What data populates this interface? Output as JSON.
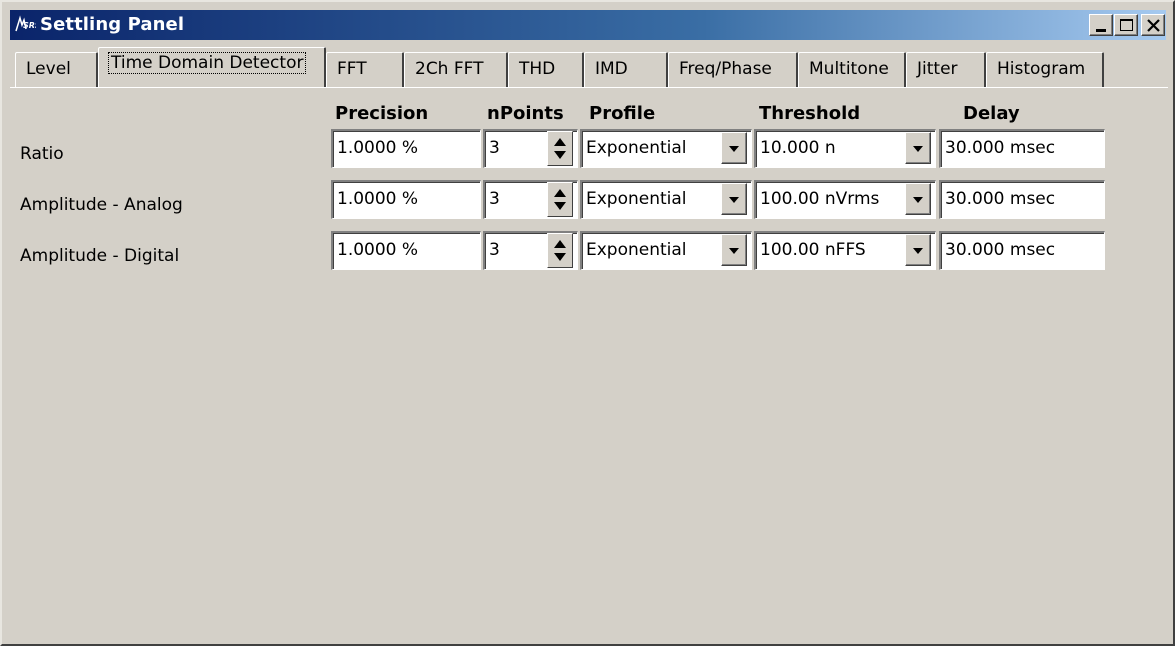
{
  "window": {
    "title": "Settling Panel",
    "app_icon": "srs-logo-icon",
    "buttons": [
      "minimize-icon",
      "maximize-icon",
      "close-icon"
    ]
  },
  "tabs": [
    {
      "label": "Level",
      "active": false
    },
    {
      "label": "Time Domain Detector",
      "active": true
    },
    {
      "label": "FFT",
      "active": false
    },
    {
      "label": "2Ch FFT",
      "active": false
    },
    {
      "label": "THD",
      "active": false
    },
    {
      "label": "IMD",
      "active": false
    },
    {
      "label": "Freq/Phase",
      "active": false
    },
    {
      "label": "Multitone",
      "active": false
    },
    {
      "label": "Jitter",
      "active": false
    },
    {
      "label": "Histogram",
      "active": false
    }
  ],
  "columns": {
    "precision": "Precision",
    "npoints": "nPoints",
    "profile": "Profile",
    "threshold": "Threshold",
    "delay": "Delay"
  },
  "rows": [
    {
      "label": "Ratio",
      "precision": "1.0000 %",
      "npoints": "3",
      "profile": "Exponential",
      "threshold": "10.000 n",
      "delay": "30.000 msec"
    },
    {
      "label": "Amplitude - Analog",
      "precision": "1.0000 %",
      "npoints": "3",
      "profile": "Exponential",
      "threshold": "100.00 nVrms",
      "delay": "30.000 msec"
    },
    {
      "label": "Amplitude - Digital",
      "precision": "1.0000 %",
      "npoints": "3",
      "profile": "Exponential",
      "threshold": "100.00 nFFS",
      "delay": "30.000 msec"
    }
  ]
}
